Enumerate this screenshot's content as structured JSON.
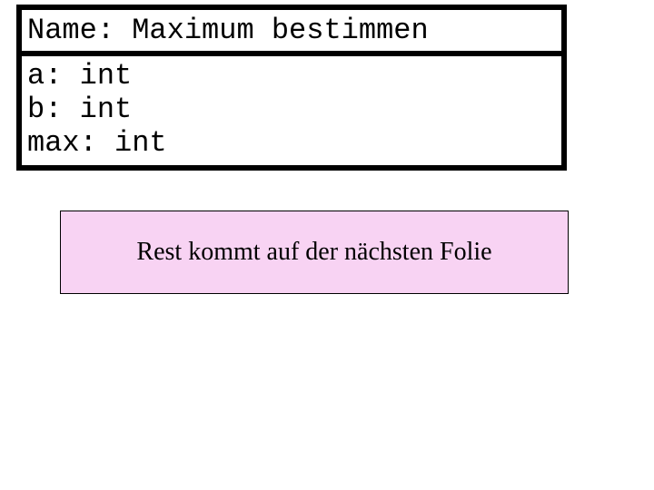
{
  "card": {
    "title": "Name: Maximum bestimmen",
    "lines": {
      "l0": "a: int",
      "l1": "b: int",
      "l2": "max: int"
    }
  },
  "note": {
    "text": "Rest kommt auf der nächsten Folie"
  },
  "colors": {
    "note_bg": "#F8D3F3"
  }
}
